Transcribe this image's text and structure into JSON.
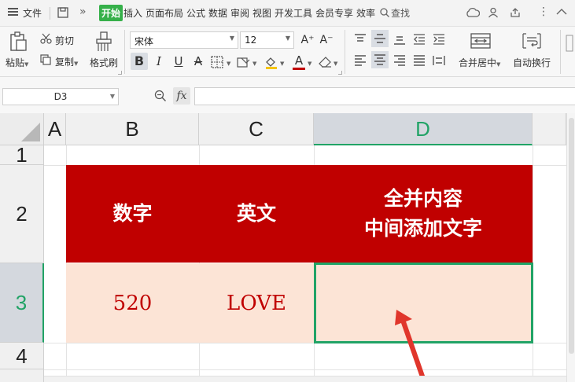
{
  "menubar": {
    "file_label": "文件",
    "tabs": [
      "开始",
      "插入",
      "页面布局",
      "公式",
      "数据",
      "审阅",
      "视图",
      "开发工具",
      "会员专享",
      "效率"
    ],
    "search_label": "查找"
  },
  "ribbon": {
    "paste_label": "粘贴",
    "cut_label": "剪切",
    "copy_label": "复制",
    "format_painter_label": "格式刷",
    "font_name": "宋体",
    "font_size": "12",
    "bold": "B",
    "italic": "I",
    "underline": "U",
    "strike": "A",
    "font_color_letter": "A",
    "increase_font": "A⁺",
    "decrease_font": "A⁻",
    "merge_center_label": "合并居中",
    "wrap_text_label": "自动换行",
    "accent_color": "#c00000"
  },
  "formula_bar": {
    "cell_reference": "D3",
    "fx_label": "fx",
    "formula_value": ""
  },
  "sheet": {
    "columns": [
      "A",
      "B",
      "C",
      "D"
    ],
    "rows": [
      "1",
      "2",
      "3",
      "4"
    ],
    "selected_column": "D",
    "selected_row": "3",
    "header_row": {
      "b": "数字",
      "c": "英文",
      "d_line1": "全并内容",
      "d_line2": "中间添加文字"
    },
    "data_row": {
      "b": "520",
      "c": "LOVE",
      "d": ""
    },
    "header_fill": "#c00000",
    "data_fill": "#fce4d6",
    "selection_color": "#21a366"
  }
}
